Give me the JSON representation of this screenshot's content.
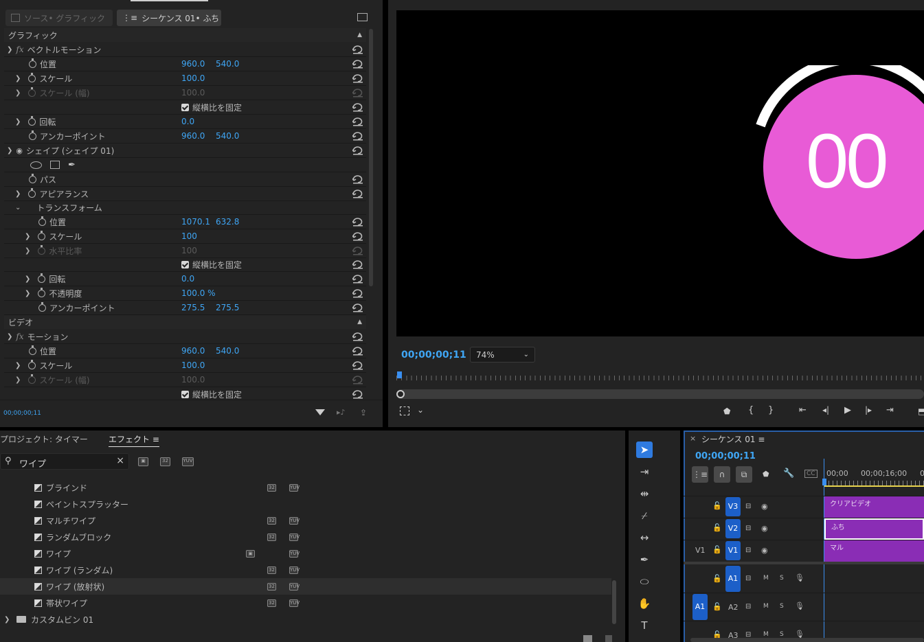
{
  "tabs": {
    "source": "ソース• グラフィック",
    "sequence": "シーケンス 01• ふち"
  },
  "graphic_header": "グラフィック",
  "video_header": "ビデオ",
  "vector_motion": "ベクトルモーション",
  "shape_label": "シェイプ (シェイプ 01)",
  "transform_label": "トランスフォーム",
  "motion_label": "モーション",
  "rows": {
    "pos": {
      "label": "位置",
      "v1": "960.0",
      "v2": "540.0"
    },
    "scale": {
      "label": "スケール",
      "v1": "100.0"
    },
    "scale_w": {
      "label": "スケール (幅)",
      "v1": "100.0"
    },
    "uniform": "縦横比を固定",
    "rot": {
      "label": "回転",
      "v1": "0.0"
    },
    "anchor": {
      "label": "アンカーポイント",
      "v1": "960.0",
      "v2": "540.0"
    },
    "path": "パス",
    "appearance": "アピアランス",
    "t_pos": {
      "label": "位置",
      "v1": "1070.1",
      "v2": "632.8"
    },
    "t_scale": {
      "label": "スケール",
      "v1": "100"
    },
    "t_hscale": {
      "label": "水平比率",
      "v1": "100"
    },
    "t_uniform": "縦横比を固定",
    "t_rot": {
      "label": "回転",
      "v1": "0.0"
    },
    "t_opacity": {
      "label": "不透明度",
      "v1": "100.0 %"
    },
    "t_anchor": {
      "label": "アンカーポイント",
      "v1": "275.5",
      "v2": "275.5"
    },
    "m_pos": {
      "label": "位置",
      "v1": "960.0",
      "v2": "540.0"
    },
    "m_scale": {
      "label": "スケール",
      "v1": "100.0"
    },
    "m_scale_w": {
      "label": "スケール (幅)",
      "v1": "100.0"
    },
    "m_uniform": "縦横比を固定"
  },
  "ec_timecode": "00;00;00;11",
  "program": {
    "timecode": "00;00;00;11",
    "zoom": "74%",
    "counter": "00",
    "circle_color": "#e85bd6"
  },
  "project_tab": "プロジェクト: タイマー",
  "effects_tab": "エフェクト",
  "search_value": "ワイプ",
  "effects": [
    "ブラインド",
    "ペイントスプラッター",
    "マルチワイプ",
    "ランダムブロック",
    "ワイプ",
    "ワイプ (ランダム)",
    "ワイプ (放射状)",
    "帯状ワイプ"
  ],
  "bin": "カスタムビン 01",
  "timeline": {
    "title": "シーケンス 01",
    "timecode": "00;00;00;11",
    "ruler": [
      "00;00",
      "00;00;16;00",
      "0"
    ],
    "clips": {
      "v3": "クリアビデオ",
      "v2": "ふち",
      "v1": "マル"
    },
    "tracks": {
      "v3": "V3",
      "v2": "V2",
      "v1": "V1",
      "v1src": "V1",
      "a1": "A1",
      "a1src": "A1",
      "a2": "A2",
      "a3": "A3"
    },
    "m": "M",
    "s": "S"
  }
}
